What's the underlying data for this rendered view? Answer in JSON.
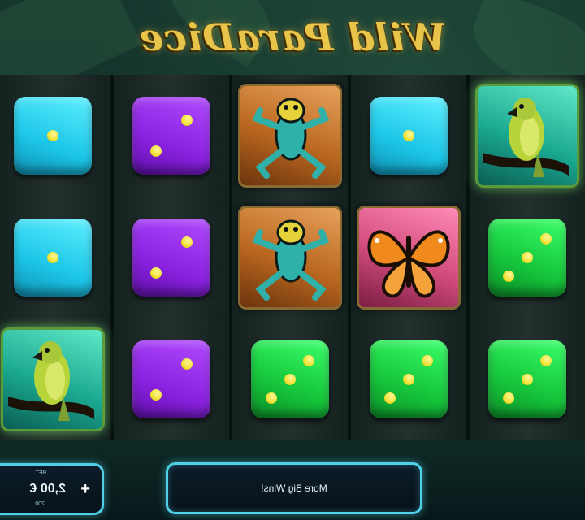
{
  "game": {
    "title": "Wild ParaDice"
  },
  "reels": {
    "columns": [
      [
        "parrot",
        "green-3",
        "green-3"
      ],
      [
        "green-3",
        "butterfly",
        "green-3"
      ],
      [
        "frog",
        "frog",
        "green-3"
      ],
      [
        "purple-2",
        "purple-2",
        "purple-2"
      ],
      [
        "cyan-1",
        "cyan-1",
        "parrot"
      ]
    ]
  },
  "bottom_bar": {
    "message": "More Big Wins!",
    "bet_label": "BET",
    "bet_value": "2,00 €",
    "bet_sub": "200",
    "plus_label": "+"
  },
  "colors": {
    "title_gold": "#e8c44a",
    "die_green": "#15c43a",
    "die_purple": "#8a22e0",
    "die_cyan": "#1cc6e8",
    "pip_yellow": "#f2e233",
    "panel_border": "#4fd0e6"
  },
  "icons": [
    "parrot-icon",
    "frog-icon",
    "butterfly-icon",
    "dice-icon",
    "plus-icon"
  ]
}
